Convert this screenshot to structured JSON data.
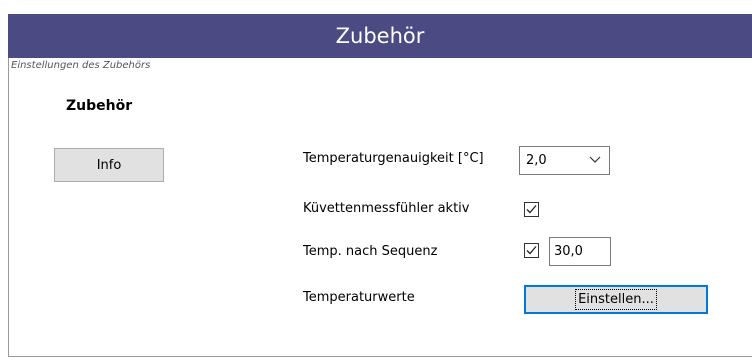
{
  "window": {
    "title": "Zubehör",
    "subtitle": "Einstellungen des Zubehörs"
  },
  "section": {
    "heading": "Zubehör"
  },
  "buttons": {
    "info_label": "Info",
    "einstellen_label": "Einstellen..."
  },
  "fields": {
    "temperaturgenauigkeit": {
      "label": "Temperaturgenauigkeit [°C]",
      "value": "2,0"
    },
    "kuevettenmessfuehler": {
      "label": "Küvettenmessfühler aktiv",
      "checked": true
    },
    "temp_nach_sequenz": {
      "label": "Temp. nach Sequenz",
      "checked": true,
      "value": "30,0"
    },
    "temperaturwerte": {
      "label": "Temperaturwerte"
    }
  },
  "colors": {
    "titlebar": "#4b4a82",
    "focus": "#0078d7"
  },
  "icons": {
    "dropdown": "chevron-down-icon",
    "check": "checkmark-icon"
  }
}
